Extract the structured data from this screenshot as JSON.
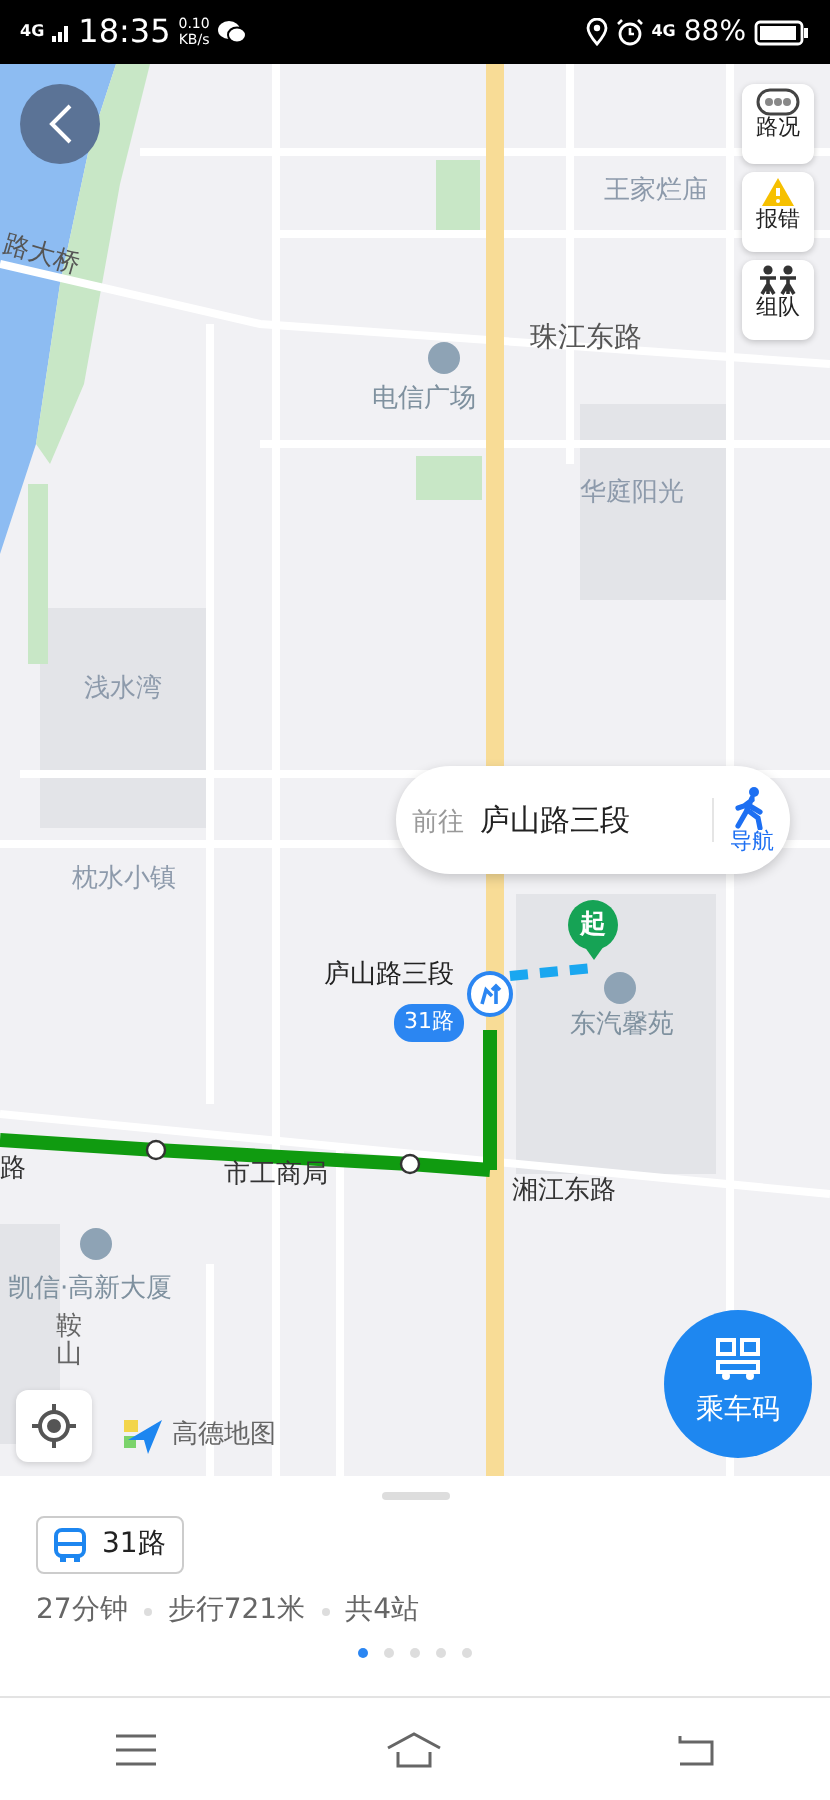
{
  "status_bar": {
    "signal_label": "4G",
    "time": "18:35",
    "net_speed": "0.10",
    "net_unit": "KB/s",
    "network_label": "4G",
    "battery": "88%"
  },
  "map": {
    "labels": [
      {
        "text": "王家烂庙",
        "kind": "area"
      },
      {
        "text": "路大桥",
        "kind": "bridge"
      },
      {
        "text": "珠江东路",
        "kind": "road"
      },
      {
        "text": "电信广场",
        "kind": "poi"
      },
      {
        "text": "华庭阳光",
        "kind": "area"
      },
      {
        "text": "浅水湾",
        "kind": "area"
      },
      {
        "text": "枕水小镇",
        "kind": "area"
      },
      {
        "text": "庐山路三段",
        "kind": "stop"
      },
      {
        "text": "东汽馨苑",
        "kind": "poi"
      },
      {
        "text": "市工商局",
        "kind": "route"
      },
      {
        "text": "湘江东路",
        "kind": "route"
      },
      {
        "text": "路",
        "kind": "route"
      },
      {
        "text": "凯信·高新大厦",
        "kind": "poi"
      },
      {
        "text": "鞍山",
        "kind": "vertical"
      }
    ],
    "line_badge": "31路",
    "start_marker": "起",
    "tools": [
      {
        "label": "路况",
        "kind": "traffic"
      },
      {
        "label": "报错",
        "kind": "report"
      },
      {
        "label": "组队",
        "kind": "team"
      }
    ],
    "popup": {
      "prefix": "前往",
      "destination": "庐山路三段",
      "action": "导航"
    },
    "logo": "高德地图",
    "ride_code": "乘车码"
  },
  "sheet": {
    "line": "31路",
    "summary": [
      "27分钟",
      "步行721米",
      "共4站"
    ],
    "pages": [
      {
        "selected": true
      },
      {
        "selected": false
      },
      {
        "selected": false
      },
      {
        "selected": false
      },
      {
        "selected": false
      }
    ]
  }
}
